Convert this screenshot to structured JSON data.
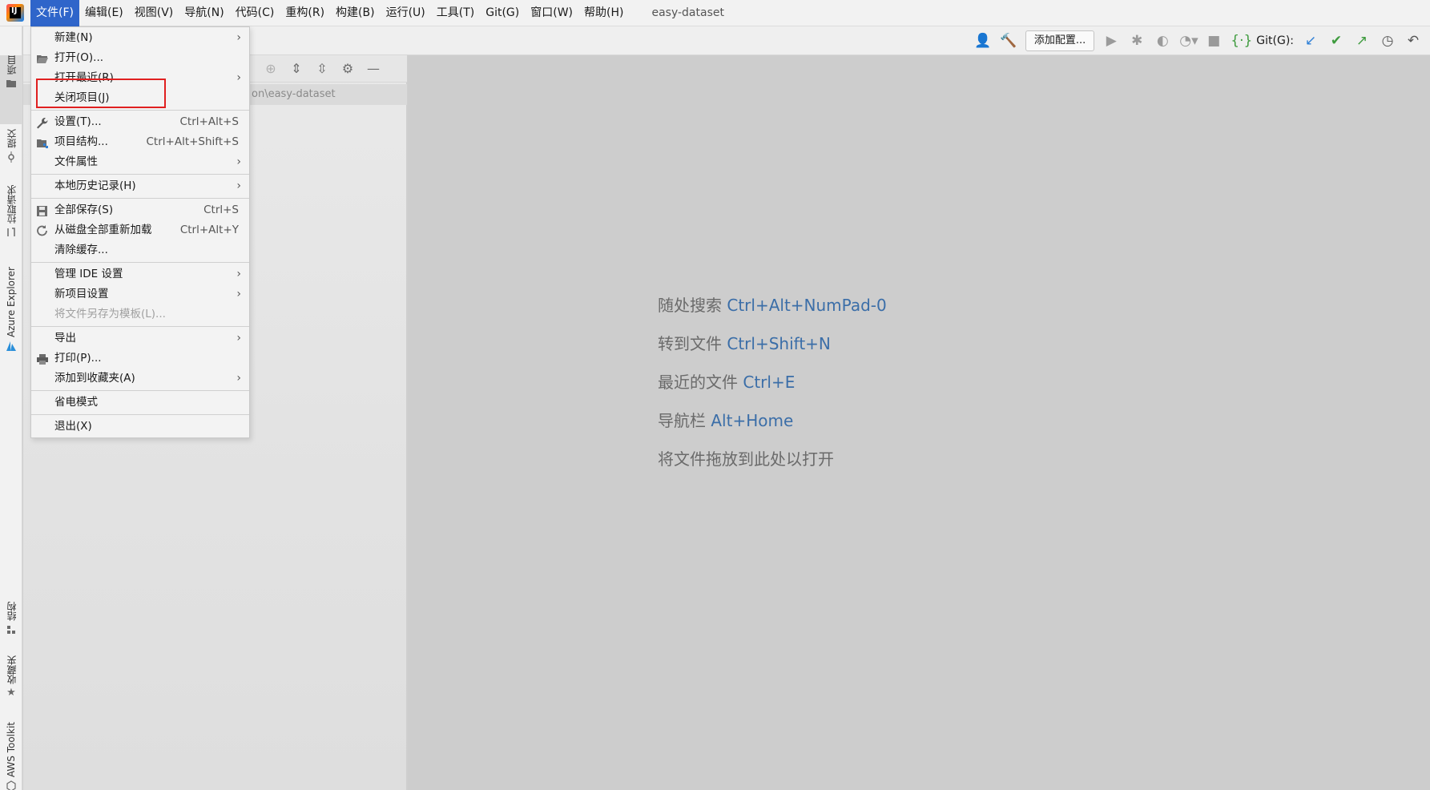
{
  "menubar": {
    "items": [
      {
        "label": "文件(F)",
        "active": true
      },
      {
        "label": "编辑(E)"
      },
      {
        "label": "视图(V)"
      },
      {
        "label": "导航(N)"
      },
      {
        "label": "代码(C)"
      },
      {
        "label": "重构(R)"
      },
      {
        "label": "构建(B)"
      },
      {
        "label": "运行(U)"
      },
      {
        "label": "工具(T)"
      },
      {
        "label": "Git(G)"
      },
      {
        "label": "窗口(W)"
      },
      {
        "label": "帮助(H)"
      }
    ],
    "project_title": "easy-dataset"
  },
  "left_stripe": {
    "tabs_top": [
      "项目",
      "提交",
      "拉取请求",
      "Azure Explorer"
    ],
    "tabs_bottom": [
      "结构",
      "收藏夹",
      "AWS Toolkit"
    ]
  },
  "toolbar": {
    "add_config_label": "添加配置...",
    "git_label": "Git(G):"
  },
  "project_panel": {
    "path_fragment": "on\\easy-dataset"
  },
  "file_menu": {
    "items": [
      {
        "label": "新建(N)",
        "submenu": true
      },
      {
        "label": "打开(O)...",
        "icon": "folder-open-icon"
      },
      {
        "label": "打开最近(R)",
        "submenu": true
      },
      {
        "label": "关闭项目(J)",
        "highlighted": true
      },
      {
        "sep": true
      },
      {
        "label": "设置(T)...",
        "shortcut": "Ctrl+Alt+S",
        "icon": "wrench-icon"
      },
      {
        "label": "项目结构...",
        "shortcut": "Ctrl+Alt+Shift+S",
        "icon": "project-structure-icon"
      },
      {
        "label": "文件属性",
        "submenu": true
      },
      {
        "sep": true
      },
      {
        "label": "本地历史记录(H)",
        "submenu": true
      },
      {
        "sep": true
      },
      {
        "label": "全部保存(S)",
        "shortcut": "Ctrl+S",
        "icon": "save-icon"
      },
      {
        "label": "从磁盘全部重新加载",
        "shortcut": "Ctrl+Alt+Y",
        "icon": "reload-icon"
      },
      {
        "label": "清除缓存..."
      },
      {
        "sep": true
      },
      {
        "label": "管理 IDE 设置",
        "submenu": true
      },
      {
        "label": "新项目设置",
        "submenu": true
      },
      {
        "label": "将文件另存为模板(L)...",
        "disabled": true
      },
      {
        "sep": true
      },
      {
        "label": "导出",
        "submenu": true
      },
      {
        "label": "打印(P)...",
        "icon": "print-icon"
      },
      {
        "label": "添加到收藏夹(A)",
        "submenu": true
      },
      {
        "sep": true
      },
      {
        "label": "省电模式"
      },
      {
        "sep": true
      },
      {
        "label": "退出(X)"
      }
    ]
  },
  "editor_hints": [
    {
      "text": "随处搜索",
      "key": "Ctrl+Alt+NumPad-0"
    },
    {
      "text": "转到文件",
      "key": "Ctrl+Shift+N"
    },
    {
      "text": "最近的文件",
      "key": "Ctrl+E"
    },
    {
      "text": "导航栏",
      "key": "Alt+Home"
    },
    {
      "text": "将文件拖放到此处以打开",
      "key": ""
    }
  ],
  "colors": {
    "accent": "#2f65ca",
    "highlight_box": "#e02020",
    "hint_key": "#3b6ea8"
  }
}
